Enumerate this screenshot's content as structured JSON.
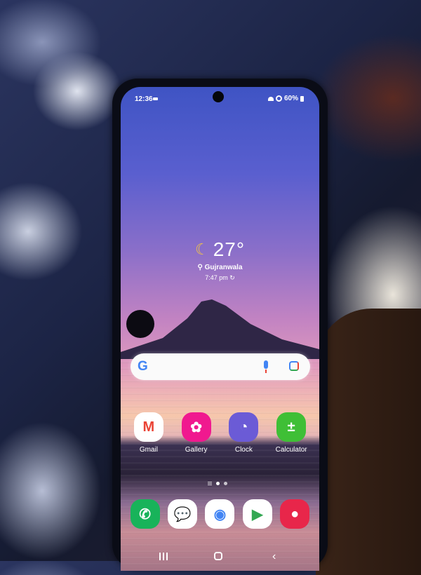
{
  "status_bar": {
    "time": "12:36",
    "battery": "60%"
  },
  "weather": {
    "icon": "moon-icon",
    "temperature": "27°",
    "location": "Gujranwala",
    "updated": "7:47 pm"
  },
  "search": {
    "logo": "G",
    "icons": [
      "mic-icon",
      "lens-icon"
    ]
  },
  "apps": [
    {
      "label": "Gmail",
      "glyph": "M",
      "color": "#ffffff",
      "fg": "#ea4335"
    },
    {
      "label": "Gallery",
      "glyph": "✿",
      "color": "#f0198f",
      "fg": "#ffffff"
    },
    {
      "label": "Clock",
      "glyph": "◔",
      "color": "#6b5bd6",
      "fg": "#ffffff"
    },
    {
      "label": "Calculator",
      "glyph": "±",
      "color": "#3fbf36",
      "fg": "#ffffff"
    }
  ],
  "page_indicator": {
    "pages": 3,
    "active": 2
  },
  "dock": [
    {
      "name": "phone",
      "glyph": "✆",
      "color": "#18b35a",
      "fg": "#ffffff"
    },
    {
      "name": "messages",
      "glyph": "💬",
      "color": "#ffffff",
      "fg": "#1a73e8"
    },
    {
      "name": "chrome",
      "glyph": "◉",
      "color": "#ffffff",
      "fg": "#4285f4"
    },
    {
      "name": "play-store",
      "glyph": "▶",
      "color": "#ffffff",
      "fg": "#34a853"
    },
    {
      "name": "camera",
      "glyph": "●",
      "color": "#e8264a",
      "fg": "#ffffff"
    }
  ],
  "nav_bar": {
    "back_glyph": "‹"
  }
}
